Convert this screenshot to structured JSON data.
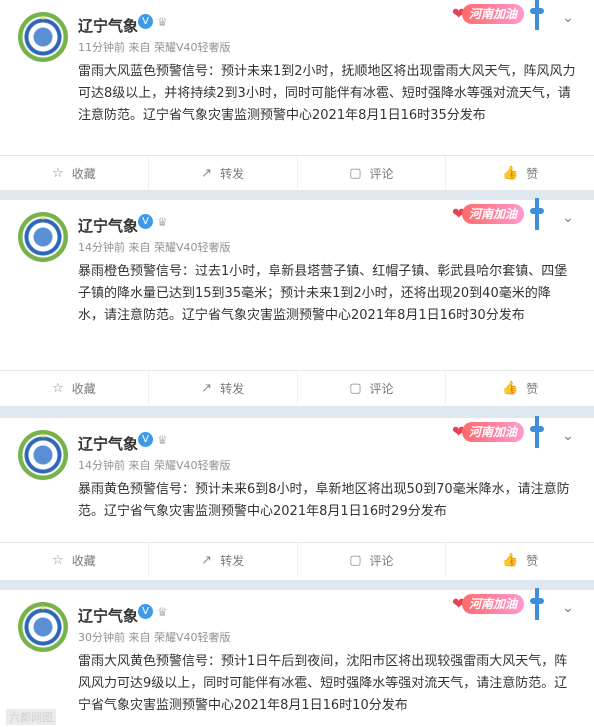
{
  "posts": [
    {
      "name": "辽宁气象",
      "meta": "11分钟前 来自 荣耀V40轻奢版",
      "badge": "河南加油",
      "content": "雷雨大风蓝色预警信号：预计未来1到2小时，抚顺地区将出现雷雨大风天气，阵风风力可达8级以上，并将持续2到3小时，同时可能伴有冰雹、短时强降水等强对流天气，请注意防范。辽宁省气象灾害监测预警中心2021年8月1日16时35分发布"
    },
    {
      "name": "辽宁气象",
      "meta": "14分钟前 来自 荣耀V40轻奢版",
      "badge": "河南加油",
      "content": "暴雨橙色预警信号：过去1小时，阜新县塔营子镇、红帽子镇、彰武县哈尔套镇、四堡子镇的降水量已达到15到35毫米；预计未来1到2小时，还将出现20到40毫米的降水，请注意防范。辽宁省气象灾害监测预警中心2021年8月1日16时30分发布"
    },
    {
      "name": "辽宁气象",
      "meta": "14分钟前 来自 荣耀V40轻奢版",
      "badge": "河南加油",
      "content": "暴雨黄色预警信号：预计未来6到8小时，阜新地区将出现50到70毫米降水，请注意防范。辽宁省气象灾害监测预警中心2021年8月1日16时29分发布"
    },
    {
      "name": "辽宁气象",
      "meta": "30分钟前 来自 荣耀V40轻奢版",
      "badge": "河南加油",
      "content": "雷雨大风黄色预警信号：预计1日午后到夜间，沈阳市区将出现较强雷雨大风天气，阵风风力可达9级以上，同时可能伴有冰雹、短时强降水等强对流天气，请注意防范。辽宁省气象灾害监测预警中心2021年8月1日16时10分发布"
    }
  ],
  "actions": {
    "collect": "收藏",
    "repost": "转发",
    "comment": "评论",
    "like": "赞"
  },
  "icons": {
    "collect": "star-outline-icon",
    "repost": "repost-icon",
    "comment": "comment-icon",
    "like": "thumbs-up-icon",
    "more": "chevron-down-icon",
    "verified": "verified-v-icon",
    "crown": "crown-icon"
  },
  "watermark": "六都网图",
  "colors": {
    "background": "#dfe8ee",
    "card": "#ffffff",
    "text": "#333333",
    "meta": "#939393",
    "verified": "#3e9ae8",
    "badge": "#ff6a6a"
  }
}
